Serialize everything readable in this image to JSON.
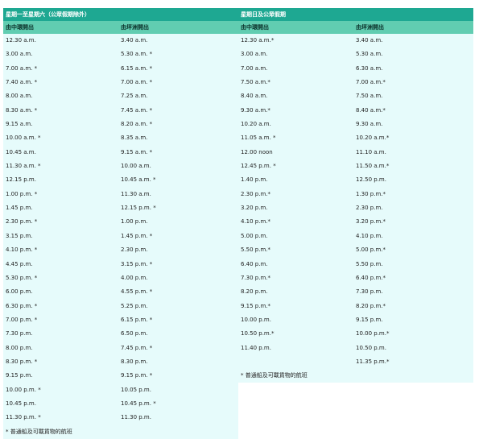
{
  "weekday": {
    "title": "星期一至星期六（公眾假期除外）",
    "col_from_central": "由中環開出",
    "col_from_island": "由坪洲開出",
    "rows": [
      [
        "12.30 a.m.",
        "3.40 a.m."
      ],
      [
        "3.00 a.m.",
        "5.30 a.m. *"
      ],
      [
        "7.00 a.m. *",
        "6.15 a.m. *"
      ],
      [
        "7.40 a.m. *",
        "7.00 a.m. *"
      ],
      [
        "8.00 a.m.",
        "7.25 a.m."
      ],
      [
        "8.30 a.m. *",
        "7.45 a.m. *"
      ],
      [
        "9.15 a.m.",
        "8.20 a.m. *"
      ],
      [
        "10.00 a.m. *",
        "8.35 a.m."
      ],
      [
        "10.45 a.m.",
        "9.15 a.m. *"
      ],
      [
        "11.30 a.m. *",
        "10.00 a.m."
      ],
      [
        "12.15 p.m.",
        "10.45 a.m. *"
      ],
      [
        "1.00 p.m. *",
        "11.30 a.m."
      ],
      [
        "1.45 p.m.",
        "12.15 p.m. *"
      ],
      [
        "2.30 p.m. *",
        "1.00 p.m."
      ],
      [
        "3.15 p.m.",
        "1.45 p.m. *"
      ],
      [
        "4.10 p.m. *",
        "2.30 p.m."
      ],
      [
        "4.45 p.m.",
        "3.15 p.m. *"
      ],
      [
        "5.30 p.m. *",
        "4.00 p.m."
      ],
      [
        "6.00 p.m.",
        "4.55 p.m. *"
      ],
      [
        "6.30 p.m. *",
        "5.25 p.m."
      ],
      [
        "7.00 p.m. *",
        "6.15 p.m. *"
      ],
      [
        "7.30 p.m.",
        "6.50 p.m."
      ],
      [
        "8.00 p.m.",
        "7.45 p.m. *"
      ],
      [
        "8.30 p.m. *",
        "8.30 p.m."
      ],
      [
        "9.15 p.m.",
        "9.15 p.m. *"
      ],
      [
        "10.00 p.m. *",
        "10.05 p.m."
      ],
      [
        "10.45 p.m.",
        "10.45 p.m. *"
      ],
      [
        "11.30 p.m. *",
        "11.30 p.m."
      ]
    ],
    "note": "* 普通船及可載貨物的航班"
  },
  "holiday": {
    "title": "星期日及公眾假期",
    "col_from_central": "由中環開出",
    "col_from_island": "由坪洲開出",
    "rows": [
      [
        "12.30 a.m.*",
        "3.40 a.m."
      ],
      [
        "3.00 a.m.",
        "5.30 a.m."
      ],
      [
        "7.00 a.m.",
        "6.30 a.m."
      ],
      [
        "7.50 a.m.*",
        "7.00 a.m.*"
      ],
      [
        "8.40 a.m.",
        "7.50 a.m."
      ],
      [
        "9.30 a.m.*",
        "8.40 a.m.*"
      ],
      [
        "10.20 a.m.",
        "9.30 a.m."
      ],
      [
        "11.05 a.m. *",
        "10.20 a.m.*"
      ],
      [
        "12.00 noon",
        "11.10 a.m."
      ],
      [
        "12.45 p.m. *",
        "11.50 a.m.*"
      ],
      [
        "1.40 p.m.",
        "12.50 p.m."
      ],
      [
        "2.30 p.m.*",
        "1.30 p.m.*"
      ],
      [
        "3.20 p.m.",
        "2.30 p.m."
      ],
      [
        "4.10 p.m.*",
        "3.20 p.m.*"
      ],
      [
        "5.00 p.m.",
        "4.10 p.m."
      ],
      [
        "5.50 p.m.*",
        "5.00 p.m.*"
      ],
      [
        "6.40 p.m.",
        "5.50 p.m."
      ],
      [
        "7.30 p.m.*",
        "6.40 p.m.*"
      ],
      [
        "8.20 p.m.",
        "7.30 p.m."
      ],
      [
        "9.15 p.m.*",
        "8.20 p.m.*"
      ],
      [
        "10.00 p.m.",
        "9.15 p.m."
      ],
      [
        "10.50 p.m.*",
        "10.00 p.m.*"
      ],
      [
        "11.40 p.m.",
        "10.50 p.m."
      ],
      [
        "",
        "11.35 p.m.*"
      ]
    ],
    "note": "* 普通船及可載貨物的航班"
  }
}
